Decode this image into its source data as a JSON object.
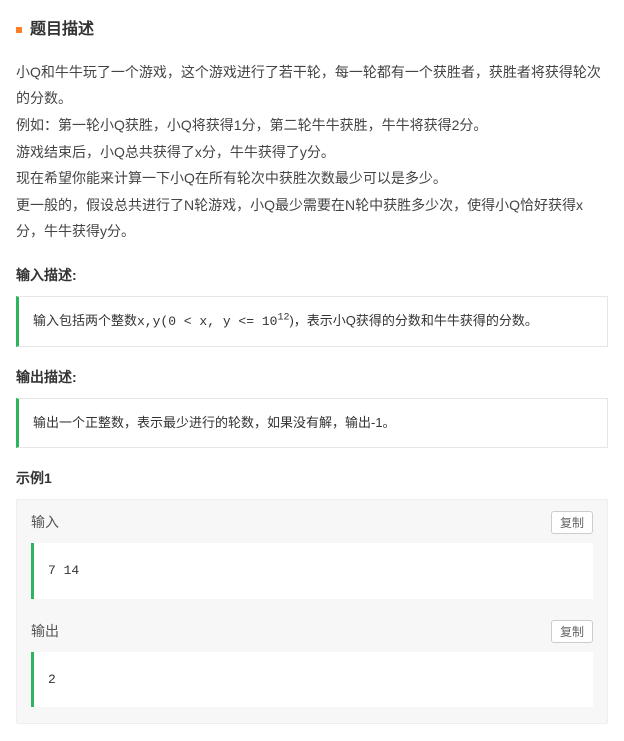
{
  "title": "题目描述",
  "description": "小Q和牛牛玩了一个游戏，这个游戏进行了若干轮，每一轮都有一个获胜者，获胜者将获得轮次的分数。\n例如：第一轮小Q获胜，小Q将获得1分，第二轮牛牛获胜，牛牛将获得2分。\n游戏结束后，小Q总共获得了x分，牛牛获得了y分。\n现在希望你能来计算一下小Q在所有轮次中获胜次数最少可以是多少。\n更一般的，假设总共进行了N轮游戏，小Q最少需要在N轮中获胜多少次，使得小Q恰好获得x分，牛牛获得y分。",
  "input_label": "输入描述:",
  "input_desc_prefix": "输入包括两个整数x,y(0 < x, y <= 10",
  "input_desc_exp": "12",
  "input_desc_suffix": ")，表示小Q获得的分数和牛牛获得的分数。",
  "output_label": "输出描述:",
  "output_desc": "输出一个正整数，表示最少进行的轮数，如果没有解，输出-1。",
  "example_label": "示例1",
  "ex_input_label": "输入",
  "ex_output_label": "输出",
  "copy_label": "复制",
  "ex_input": "7 14",
  "ex_output": "2"
}
